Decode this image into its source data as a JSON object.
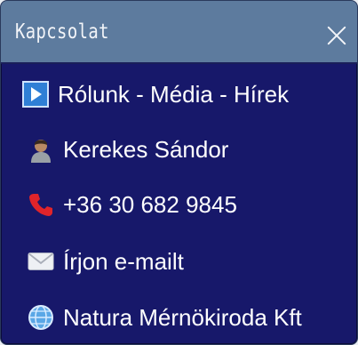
{
  "dialog": {
    "title": "Kapcsolat",
    "close_icon": "close-icon"
  },
  "items": [
    {
      "label": "Rólunk - Média - Hírek",
      "icon": "play-button-icon"
    },
    {
      "label": "Kerekes Sándor",
      "icon": "person-icon"
    },
    {
      "label": "+36 30 682 9845",
      "icon": "telephone-icon"
    },
    {
      "label": "Írjon e-mailt",
      "icon": "envelope-icon"
    },
    {
      "label": "Natura Mérnökiroda Kft",
      "icon": "globe-icon"
    }
  ],
  "colors": {
    "header": "#5d7b9e",
    "body": "#17186a",
    "text": "#ffffff"
  }
}
